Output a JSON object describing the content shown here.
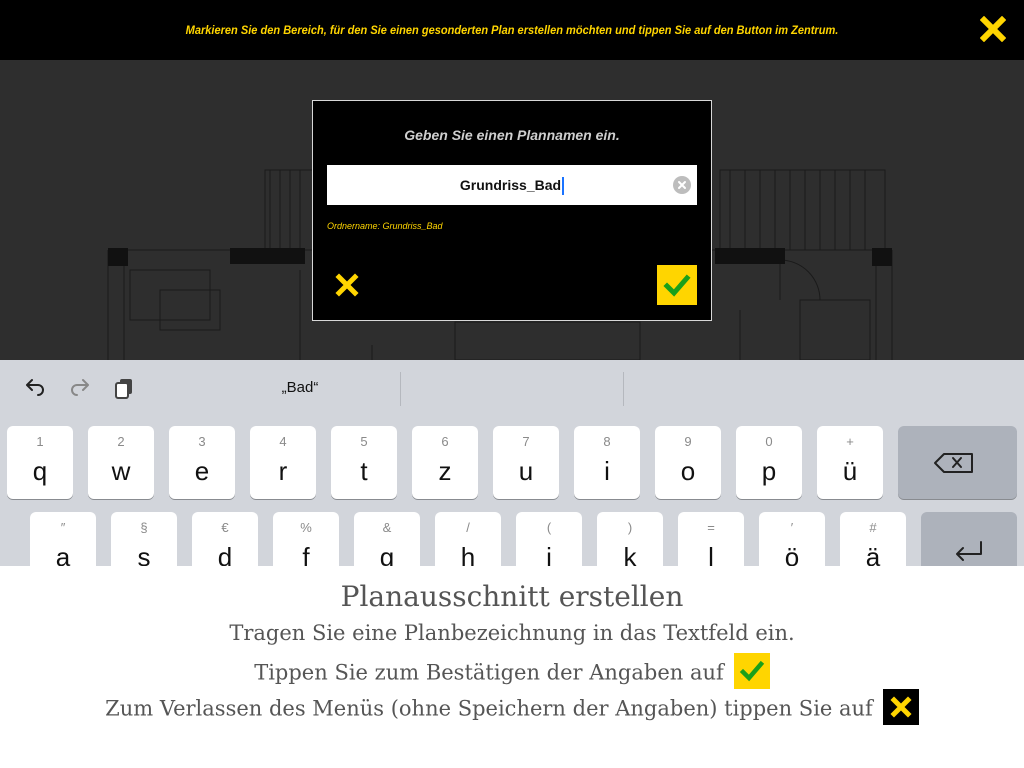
{
  "top_bar": {
    "message": "Markieren Sie den Bereich, für den Sie einen gesonderten Plan erstellen möchten und tippen Sie auf den Button im Zentrum.",
    "close_icon": "close-x-icon"
  },
  "dialog": {
    "prompt": "Geben Sie einen Plannamen ein.",
    "input_value": "Grundriss_Bad",
    "folder_label": "Ordnername: Grundriss_Bad",
    "cancel_icon": "close-x-icon",
    "confirm_icon": "checkmark-icon"
  },
  "keyboard": {
    "toolbar": {
      "undo_icon": "undo-icon",
      "redo_icon": "redo-icon",
      "clipboard_icon": "clipboard-icon",
      "suggestion": "„Bad“"
    },
    "row1": [
      {
        "sub": "1",
        "main": "q"
      },
      {
        "sub": "2",
        "main": "w"
      },
      {
        "sub": "3",
        "main": "e"
      },
      {
        "sub": "4",
        "main": "r"
      },
      {
        "sub": "5",
        "main": "t"
      },
      {
        "sub": "6",
        "main": "z"
      },
      {
        "sub": "7",
        "main": "u"
      },
      {
        "sub": "8",
        "main": "i"
      },
      {
        "sub": "9",
        "main": "o"
      },
      {
        "sub": "0",
        "main": "p"
      },
      {
        "sub": "+",
        "main": "ü"
      }
    ],
    "row2": [
      {
        "sub": "″",
        "main": "a"
      },
      {
        "sub": "§",
        "main": "s"
      },
      {
        "sub": "€",
        "main": "d"
      },
      {
        "sub": "%",
        "main": "f"
      },
      {
        "sub": "&",
        "main": "g"
      },
      {
        "sub": "/",
        "main": "h"
      },
      {
        "sub": "(",
        "main": "j"
      },
      {
        "sub": ")",
        "main": "k"
      },
      {
        "sub": "=",
        "main": "l"
      },
      {
        "sub": "′",
        "main": "ö"
      },
      {
        "sub": "#",
        "main": "ä"
      }
    ],
    "backspace_icon": "backspace-icon",
    "return_icon": "return-icon"
  },
  "help": {
    "title": "Planausschnitt erstellen",
    "line1": "Tragen Sie eine Planbezeichnung in das Textfeld ein.",
    "line2": "Tippen Sie zum Bestätigen der Angaben auf",
    "line3": "Zum Verlassen des Menüs (ohne Speichern der Angaben) tippen Sie auf"
  },
  "colors": {
    "accent_yellow": "#ffd500",
    "check_green": "#1aa01a",
    "banner_bg": "#000000",
    "plan_bg": "#2e2e2e",
    "keyboard_bg": "#d2d5db"
  }
}
